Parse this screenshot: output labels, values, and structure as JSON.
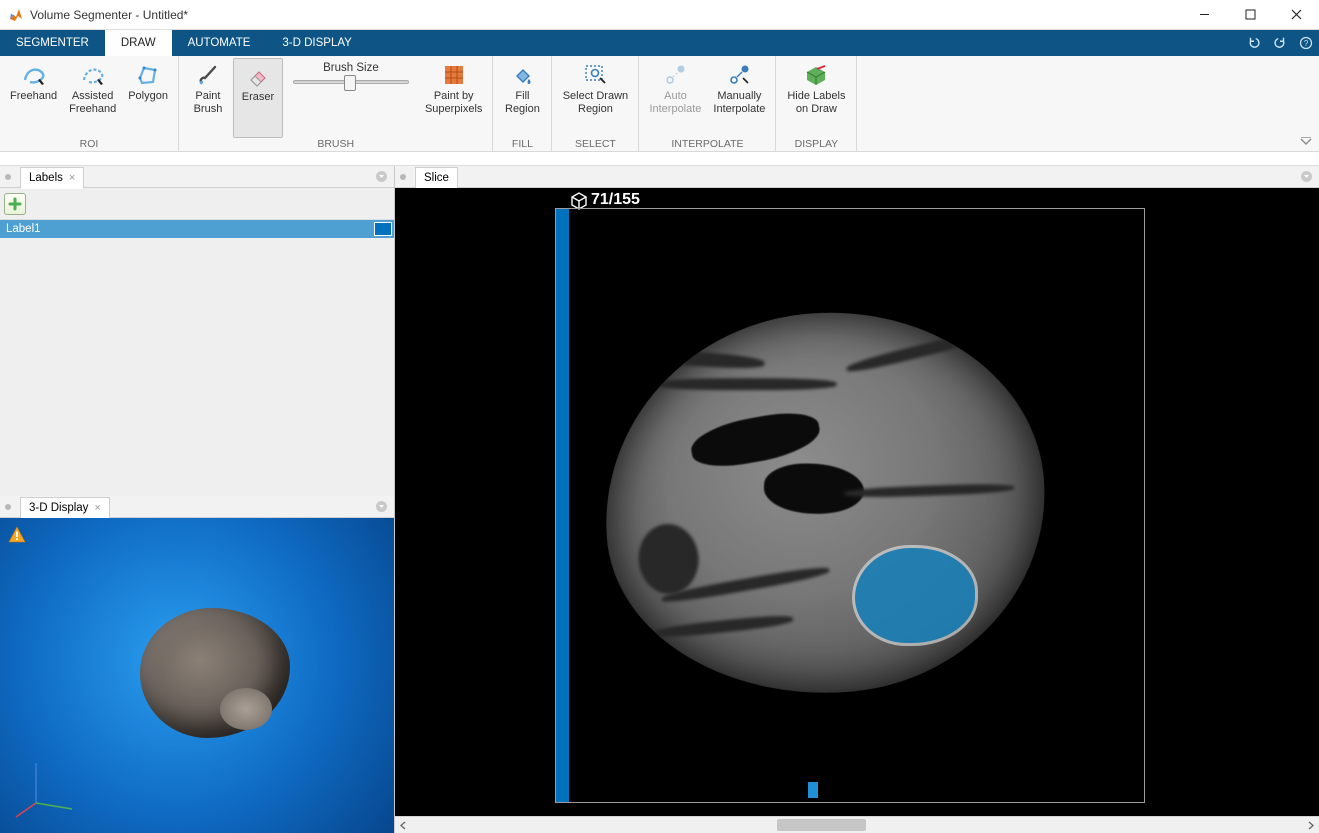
{
  "window": {
    "title": "Volume Segmenter - Untitled*"
  },
  "tabs": {
    "segmenter": "SEGMENTER",
    "draw": "DRAW",
    "automate": "AUTOMATE",
    "display3d": "3-D DISPLAY",
    "active": "draw"
  },
  "ribbon": {
    "roi": {
      "group_label": "ROI",
      "freehand": "Freehand",
      "assisted_freehand_l1": "Assisted",
      "assisted_freehand_l2": "Freehand",
      "polygon": "Polygon"
    },
    "brush": {
      "group_label": "BRUSH",
      "paint_brush_l1": "Paint",
      "paint_brush_l2": "Brush",
      "eraser": "Eraser",
      "brush_size_label": "Brush Size",
      "paint_sp_l1": "Paint by",
      "paint_sp_l2": "Superpixels"
    },
    "fill": {
      "group_label": "FILL",
      "fill_l1": "Fill",
      "fill_l2": "Region"
    },
    "select": {
      "group_label": "SELECT",
      "select_l1": "Select Drawn",
      "select_l2": "Region"
    },
    "interpolate": {
      "group_label": "INTERPOLATE",
      "auto_l1": "Auto",
      "auto_l2": "Interpolate",
      "manual_l1": "Manually",
      "manual_l2": "Interpolate"
    },
    "display": {
      "group_label": "DISPLAY",
      "hide_l1": "Hide Labels",
      "hide_l2": "on Draw"
    }
  },
  "panels": {
    "labels_tab": "Labels",
    "display3d_tab": "3-D Display",
    "slice_tab": "Slice"
  },
  "labels": {
    "items": [
      {
        "name": "Label1",
        "color": "#0072bd"
      }
    ]
  },
  "slice": {
    "current": 71,
    "total": 155,
    "counter_text": "71/155"
  }
}
